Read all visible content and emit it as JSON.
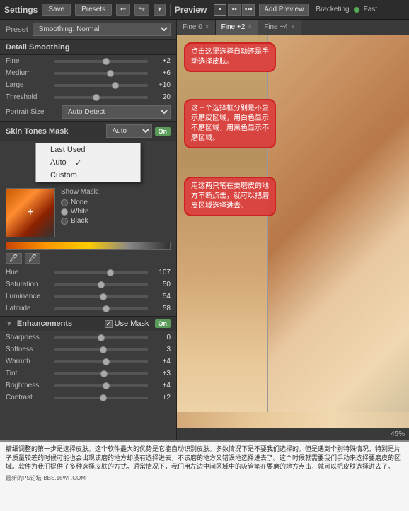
{
  "topbar": {
    "title": "Settings",
    "save_label": "Save",
    "presets_label": "Presets",
    "undo_icon": "↩",
    "redo_icon": "↪",
    "arrow_icon": "▾"
  },
  "preview_header": {
    "title": "Preview",
    "view_single": "▪",
    "view_dual": "▪▪",
    "view_triple": "▪▪▪",
    "add_preview": "Add Preview",
    "bracketing": "Bracketing",
    "fast_label": "Fast"
  },
  "tabs": [
    {
      "label": "Fine 0",
      "closable": true
    },
    {
      "label": "Fine +2",
      "closable": true
    },
    {
      "label": "Fine +4",
      "closable": true
    }
  ],
  "preset": {
    "label": "Preset",
    "value": "Smoothing: Normal"
  },
  "detail_smoothing": {
    "title": "Detail Smoothing",
    "sliders": [
      {
        "label": "Fine",
        "value": "+2",
        "pos": "55%"
      },
      {
        "label": "Medium",
        "value": "+6",
        "pos": "60%"
      },
      {
        "label": "Large",
        "value": "+10",
        "pos": "65%"
      },
      {
        "label": "Threshold",
        "value": "20",
        "pos": "45%"
      }
    ]
  },
  "portrait_size": {
    "label": "Portrait Size",
    "value": "Auto Detect"
  },
  "skin_tones_mask": {
    "title": "Skin Tones Mask",
    "select_value": "Auto",
    "on_label": "On",
    "dropdown_items": [
      {
        "label": "Last Used",
        "checked": false
      },
      {
        "label": "Auto",
        "checked": true
      },
      {
        "label": "Custom",
        "checked": false
      }
    ],
    "show_mask_label": "Show Mask:",
    "show_mask_options": [
      {
        "label": "None",
        "active": false
      },
      {
        "label": "White",
        "active": true
      },
      {
        "label": "Black",
        "active": false
      }
    ]
  },
  "hsl_sliders": [
    {
      "label": "Hue",
      "value": "107",
      "pos": "60%"
    },
    {
      "label": "Saturation",
      "value": "50",
      "pos": "50%"
    },
    {
      "label": "Luminance",
      "value": "54",
      "pos": "52%"
    },
    {
      "label": "Latitude",
      "value": "58",
      "pos": "55%"
    }
  ],
  "enhancements": {
    "title": "Enhancements",
    "use_mask_label": "Use Mask",
    "on_label": "On",
    "sliders": [
      {
        "label": "Sharpness",
        "value": "0",
        "pos": "50%"
      },
      {
        "label": "Softness",
        "value": "3",
        "pos": "52%"
      },
      {
        "label": "Warmth",
        "value": "+4",
        "pos": "55%"
      },
      {
        "label": "Tint",
        "value": "+3",
        "pos": "53%"
      },
      {
        "label": "Brightness",
        "value": "+4",
        "pos": "55%"
      },
      {
        "label": "Contrast",
        "value": "+2",
        "pos": "52%"
      }
    ]
  },
  "annotations": {
    "bubble1": "点击这里选择自动还是手动选择皮肤。",
    "bubble2": "这三个选择框分别是不显示磨皮区域，用白色显示不磨区域，用黑色显示不磨区域。",
    "bubble3": "用这两只笔在要磨皮的地方不断点击，就可以把磨皮区域选择进去。"
  },
  "bottom_text": "精细调整的第一步是选择皮肤。这个软件最大的优势是它能自动识别皮肤。多数情况下是不要我们选择的。但是遇到个别特殊情况，特别是片子质量较差的时候可能也会出现该磨的地方却没有选择进去，不该磨的地方又错误地选择进去了。这个时候就需要我们手动来选择要磨皮的区域。软件为我们提供了多种选择皮肤的方式。通常情况下，我们用左边中间区域中的吸管笔在要磨的地方点击，就可以把皮肤选择进去了。",
  "footer": {
    "site": "最新的PS论坛-BBS.16WF.COM",
    "zoom": "45%"
  }
}
